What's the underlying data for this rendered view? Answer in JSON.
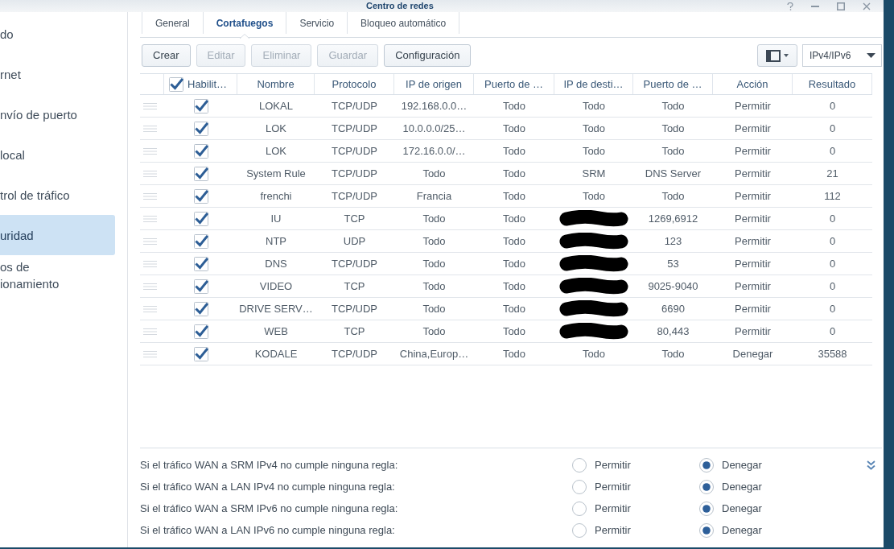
{
  "window": {
    "title": "Centro de redes"
  },
  "sidebar": {
    "items": [
      {
        "label": "do",
        "selected": false
      },
      {
        "label": "rnet",
        "selected": false
      },
      {
        "label": "nvío de puerto",
        "selected": false
      },
      {
        "label": "local",
        "selected": false
      },
      {
        "label": "trol de tráfico",
        "selected": false
      },
      {
        "label": "uridad",
        "selected": true
      },
      {
        "label": "os de\nionamiento",
        "selected": false
      }
    ]
  },
  "tabs": [
    {
      "label": "General",
      "selected": false
    },
    {
      "label": "Cortafuegos",
      "selected": true
    },
    {
      "label": "Servicio",
      "selected": false
    },
    {
      "label": "Bloqueo automático",
      "selected": false
    }
  ],
  "toolbar": {
    "buttons": [
      {
        "label": "Crear",
        "disabled": false
      },
      {
        "label": "Editar",
        "disabled": true
      },
      {
        "label": "Eliminar",
        "disabled": true
      },
      {
        "label": "Guardar",
        "disabled": true
      },
      {
        "label": "Configuración",
        "disabled": false
      }
    ],
    "filter": {
      "value": "IPv4/IPv6"
    }
  },
  "table": {
    "enable_all": {
      "label": "Habilit…",
      "checked": true
    },
    "columns": [
      "Nombre",
      "Protocolo",
      "IP de origen",
      "Puerto de …",
      "IP de desti…",
      "Puerto de …",
      "Acción",
      "Resultado"
    ],
    "rows": [
      {
        "enabled": true,
        "name": "LOKAL",
        "protocol": "TCP/UDP",
        "source_ip": "192.168.0.0…",
        "source_port": "Todo",
        "destination_ip": "Todo",
        "destination_redacted": false,
        "destination_port": "Todo",
        "action": "Permitir",
        "result": "0"
      },
      {
        "enabled": true,
        "name": "LOK",
        "protocol": "TCP/UDP",
        "source_ip": "10.0.0.0/25…",
        "source_port": "Todo",
        "destination_ip": "Todo",
        "destination_redacted": false,
        "destination_port": "Todo",
        "action": "Permitir",
        "result": "0"
      },
      {
        "enabled": true,
        "name": "LOK",
        "protocol": "TCP/UDP",
        "source_ip": "172.16.0.0/…",
        "source_port": "Todo",
        "destination_ip": "Todo",
        "destination_redacted": false,
        "destination_port": "Todo",
        "action": "Permitir",
        "result": "0"
      },
      {
        "enabled": true,
        "name": "System Rule",
        "protocol": "TCP/UDP",
        "source_ip": "Todo",
        "source_port": "Todo",
        "destination_ip": "SRM",
        "destination_redacted": false,
        "destination_port": "DNS Server",
        "action": "Permitir",
        "result": "21"
      },
      {
        "enabled": true,
        "name": "frenchi",
        "protocol": "TCP/UDP",
        "source_ip": "Francia",
        "source_port": "Todo",
        "destination_ip": "Todo",
        "destination_redacted": false,
        "destination_port": "Todo",
        "action": "Permitir",
        "result": "112"
      },
      {
        "enabled": true,
        "name": "IU",
        "protocol": "TCP",
        "source_ip": "Todo",
        "source_port": "Todo",
        "destination_redacted": true,
        "destination_port": "1269,6912",
        "action": "Permitir",
        "result": "0"
      },
      {
        "enabled": true,
        "name": "NTP",
        "protocol": "UDP",
        "source_ip": "Todo",
        "source_port": "Todo",
        "destination_redacted": true,
        "destination_port": "123",
        "action": "Permitir",
        "result": "0"
      },
      {
        "enabled": true,
        "name": "DNS",
        "protocol": "TCP/UDP",
        "source_ip": "Todo",
        "source_port": "Todo",
        "destination_redacted": true,
        "destination_port": "53",
        "action": "Permitir",
        "result": "0"
      },
      {
        "enabled": true,
        "name": "VIDEO",
        "protocol": "TCP",
        "source_ip": "Todo",
        "source_port": "Todo",
        "destination_redacted": true,
        "destination_port": "9025-9040",
        "action": "Permitir",
        "result": "0"
      },
      {
        "enabled": true,
        "name": "DRIVE SERV…",
        "protocol": "TCP/UDP",
        "source_ip": "Todo",
        "source_port": "Todo",
        "destination_redacted": true,
        "destination_port": "6690",
        "action": "Permitir",
        "result": "0"
      },
      {
        "enabled": true,
        "name": "WEB",
        "protocol": "TCP",
        "source_ip": "Todo",
        "source_port": "Todo",
        "destination_redacted": true,
        "destination_port": "80,443",
        "action": "Permitir",
        "result": "0"
      },
      {
        "enabled": true,
        "name": "KODALE",
        "protocol": "TCP/UDP",
        "source_ip": "China,Europ…",
        "source_port": "Todo",
        "destination_ip": "Todo",
        "destination_redacted": false,
        "destination_port": "Todo",
        "action": "Denegar",
        "result": "35588"
      }
    ]
  },
  "default_policies": [
    {
      "label": "Si el tráfico WAN a SRM IPv4 no cumple ninguna regla:",
      "options": [
        {
          "label": "Permitir",
          "selected": false
        },
        {
          "label": "Denegar",
          "selected": true
        }
      ]
    },
    {
      "label": "Si el tráfico WAN a LAN IPv4 no cumple ninguna regla:",
      "options": [
        {
          "label": "Permitir",
          "selected": false
        },
        {
          "label": "Denegar",
          "selected": true
        }
      ]
    },
    {
      "label": "Si el tráfico WAN a SRM IPv6 no cumple ninguna regla:",
      "options": [
        {
          "label": "Permitir",
          "selected": false
        },
        {
          "label": "Denegar",
          "selected": true
        }
      ]
    },
    {
      "label": "Si el tráfico WAN a LAN IPv6 no cumple ninguna regla:",
      "options": [
        {
          "label": "Permitir",
          "selected": false
        },
        {
          "label": "Denegar",
          "selected": true
        }
      ]
    }
  ]
}
